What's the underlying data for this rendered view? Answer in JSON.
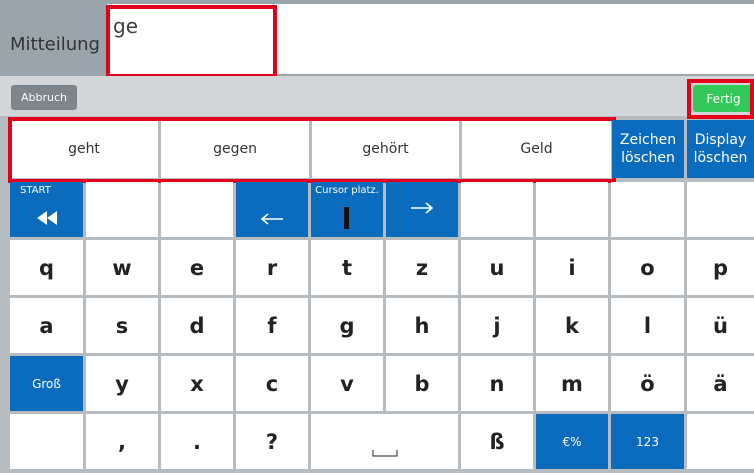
{
  "message": {
    "label": "Mitteilung",
    "text": "ge"
  },
  "buttons": {
    "cancel": "Abbruch",
    "done": "Fertig",
    "delete_char": [
      "Zeichen",
      "löschen"
    ],
    "clear_display": [
      "Display",
      "löschen"
    ]
  },
  "predictions": [
    "geht",
    "gegen",
    "gehört",
    "Geld"
  ],
  "special": {
    "start": "START",
    "cursor": "Cursor platz.",
    "shift": "Groß",
    "euro": "€%",
    "numbers": "123"
  },
  "rows": {
    "row1": [
      "q",
      "w",
      "e",
      "r",
      "t",
      "z",
      "u",
      "i",
      "o",
      "p"
    ],
    "row2": [
      "a",
      "s",
      "d",
      "f",
      "g",
      "h",
      "j",
      "k",
      "l",
      "ü"
    ],
    "row3": [
      "y",
      "x",
      "c",
      "v",
      "b",
      "n",
      "m",
      "ö",
      "ä"
    ],
    "row4": [
      ",",
      ".",
      "?",
      "ß"
    ]
  },
  "icons": {
    "start": "double-left-arrow-icon",
    "left": "left-arrow-icon",
    "cursor": "text-cursor-icon",
    "right": "right-arrow-icon",
    "space": "space-icon"
  },
  "colors": {
    "blue": "#0b6bbd",
    "green": "#34c759",
    "highlight": "#e3001b"
  }
}
